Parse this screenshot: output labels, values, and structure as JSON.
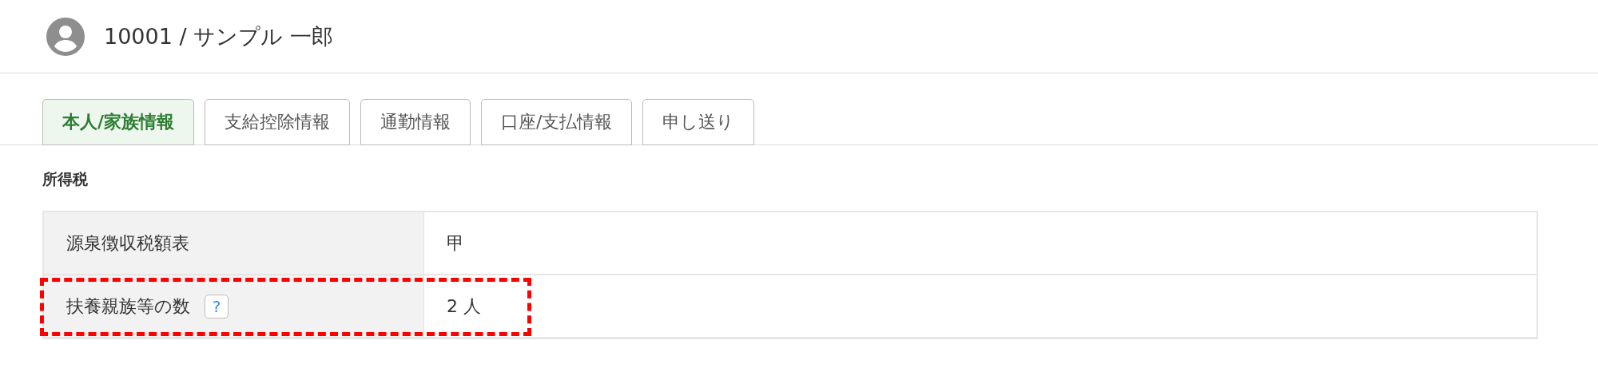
{
  "header": {
    "title": "10001 / サンプル 一郎"
  },
  "tabs": [
    {
      "label": "本人/家族情報",
      "selected": true
    },
    {
      "label": "支給控除情報",
      "selected": false
    },
    {
      "label": "通勤情報",
      "selected": false
    },
    {
      "label": "口座/支払情報",
      "selected": false
    },
    {
      "label": "申し送り",
      "selected": false
    }
  ],
  "section": {
    "title": "所得税",
    "rows": [
      {
        "label": "源泉徴収税額表",
        "value": "甲",
        "help": false,
        "highlighted": false
      },
      {
        "label": "扶養親族等の数",
        "value": "2 人",
        "help": true,
        "help_text": "?",
        "highlighted": true
      }
    ]
  }
}
